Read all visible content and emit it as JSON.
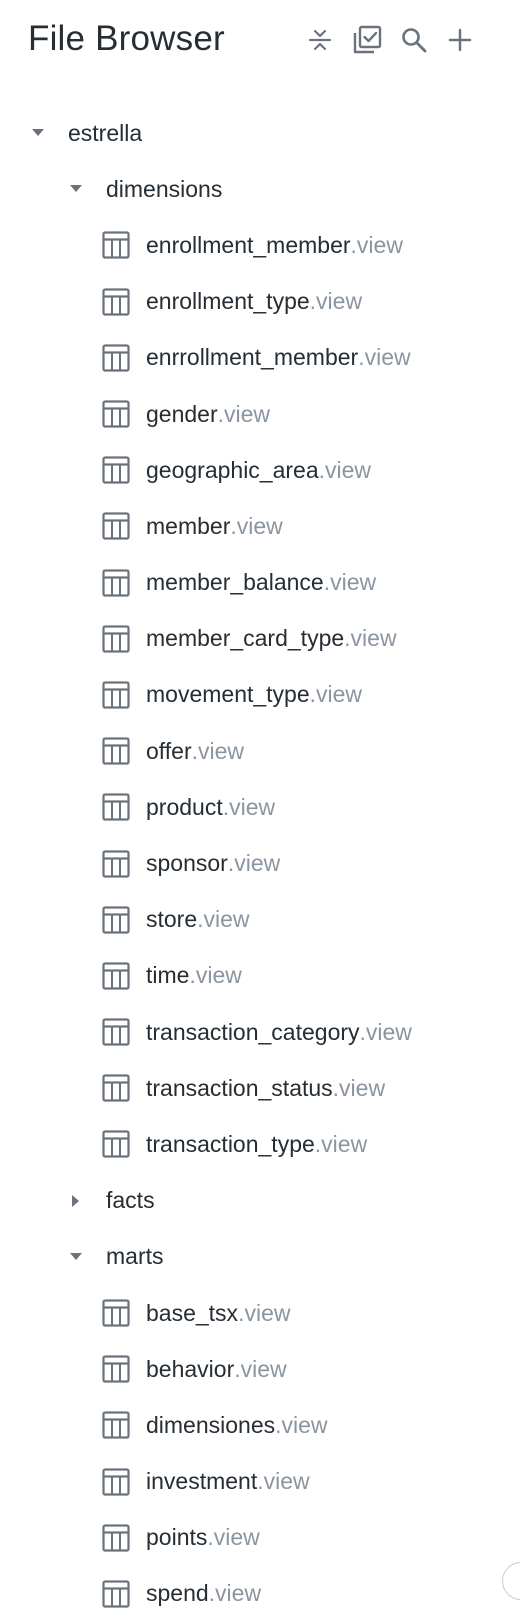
{
  "header": {
    "title": "File Browser",
    "icons": [
      "collapse-all-icon",
      "select-multiple-icon",
      "search-icon",
      "add-icon"
    ]
  },
  "tree": {
    "root": {
      "label": "estrella",
      "expanded": true
    },
    "folders": {
      "dimensions": {
        "label": "dimensions",
        "expanded": true,
        "files": [
          {
            "name": "enrollment_member",
            "ext": ".view"
          },
          {
            "name": "enrollment_type",
            "ext": ".view"
          },
          {
            "name": "enrrollment_member",
            "ext": ".view"
          },
          {
            "name": "gender",
            "ext": ".view"
          },
          {
            "name": "geographic_area",
            "ext": ".view"
          },
          {
            "name": "member",
            "ext": ".view"
          },
          {
            "name": "member_balance",
            "ext": ".view"
          },
          {
            "name": "member_card_type",
            "ext": ".view"
          },
          {
            "name": "movement_type",
            "ext": ".view"
          },
          {
            "name": "offer",
            "ext": ".view"
          },
          {
            "name": "product",
            "ext": ".view"
          },
          {
            "name": "sponsor",
            "ext": ".view"
          },
          {
            "name": "store",
            "ext": ".view"
          },
          {
            "name": "time",
            "ext": ".view"
          },
          {
            "name": "transaction_category",
            "ext": ".view"
          },
          {
            "name": "transaction_status",
            "ext": ".view"
          },
          {
            "name": "transaction_type",
            "ext": ".view"
          }
        ]
      },
      "facts": {
        "label": "facts",
        "expanded": false
      },
      "marts": {
        "label": "marts",
        "expanded": true,
        "files": [
          {
            "name": "base_tsx",
            "ext": ".view"
          },
          {
            "name": "behavior",
            "ext": ".view"
          },
          {
            "name": "dimensiones",
            "ext": ".view"
          },
          {
            "name": "investment",
            "ext": ".view"
          },
          {
            "name": "points",
            "ext": ".view"
          },
          {
            "name": "spend",
            "ext": ".view"
          }
        ]
      }
    }
  },
  "colors": {
    "text": "#262d33",
    "muted": "#8a95a0",
    "icon": "#6a737d"
  }
}
